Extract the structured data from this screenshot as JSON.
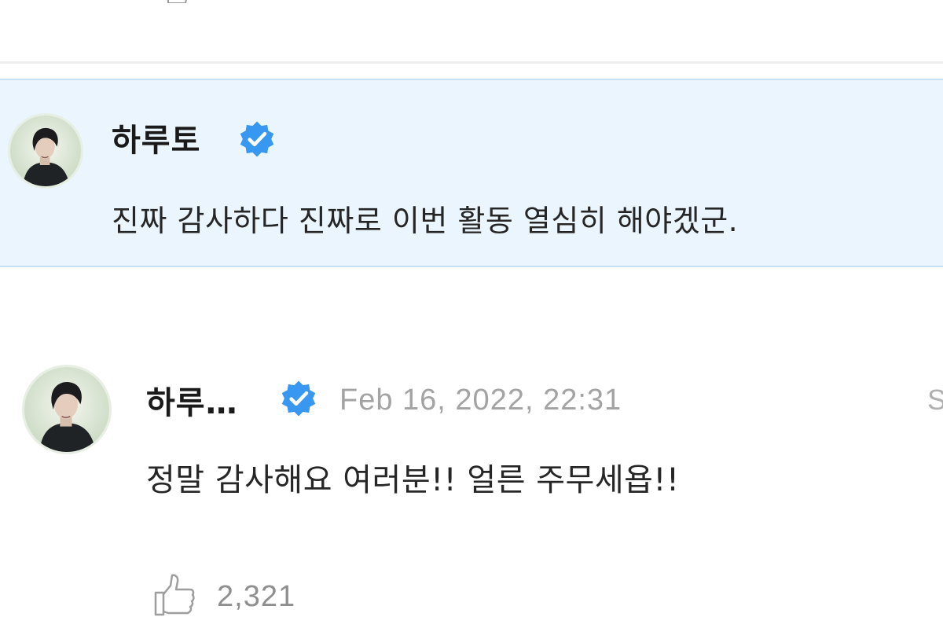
{
  "pinned_comment": {
    "author": "하루토",
    "verified": true,
    "text": "진짜 감사하다 진짜로 이번 활동 열심히 해야겠군."
  },
  "reply": {
    "author": "하루…",
    "verified": true,
    "timestamp": "Feb 16, 2022, 22:31",
    "more_label": "S",
    "text": "정말 감사해요 여러분!! 얼른 주무세욥!!",
    "like_count": "2,321"
  },
  "icons": {
    "verified": "verified-check-icon",
    "like": "thumbs-up-icon"
  },
  "colors": {
    "verified_blue": "#3897f0",
    "pinned_background": "#eaf5fd",
    "pinned_border": "#c6e1f4",
    "timestamp_gray": "#a3a3a3"
  }
}
